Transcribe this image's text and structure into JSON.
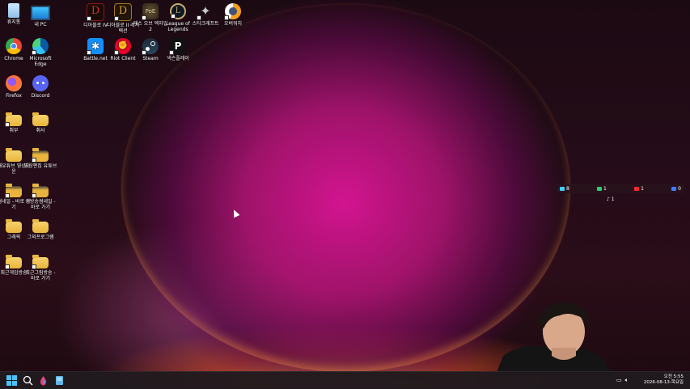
{
  "desktop_icons": [
    {
      "label": "휴지통",
      "icon": "recycle-bin-icon"
    },
    {
      "label": "내 PC",
      "icon": "pc-icon"
    },
    {
      "label": "Chrome",
      "icon": "chrome-icon"
    },
    {
      "label": "Microsoft Edge",
      "icon": "edge-icon"
    },
    {
      "label": "Firefox",
      "icon": "firefox-icon"
    },
    {
      "label": "Discord",
      "icon": "discord-icon"
    },
    {
      "label": "취부",
      "icon": "folder-icon"
    },
    {
      "label": "취사",
      "icon": "folder-icon"
    },
    {
      "label": "내유튜브 영상다운",
      "icon": "folder-icon"
    },
    {
      "label": "영상편집 유튜브",
      "icon": "folder-icon"
    },
    {
      "label": "썸네일 - 바로 가기",
      "icon": "folder-icon"
    },
    {
      "label": "생방송썸네일 - 바로 가기",
      "icon": "folder-icon"
    },
    {
      "label": "그래픽",
      "icon": "folder-icon"
    },
    {
      "label": "그외프로그램",
      "icon": "folder-icon"
    },
    {
      "label": "최근게임방송",
      "icon": "folder-icon"
    },
    {
      "label": "최근그림방송 - 바로 가기",
      "icon": "folder-icon"
    },
    {
      "label": "디아블로 IV",
      "icon": "diablo4-icon"
    },
    {
      "label": "디아블로 II 레저렉션",
      "icon": "diablo2-icon"
    },
    {
      "label": "패스 오브 엑자일2",
      "icon": "poe2-icon"
    },
    {
      "label": "League of Legends",
      "icon": "lol-icon"
    },
    {
      "label": "스타크래프트",
      "icon": "starcraft-icon"
    },
    {
      "label": "오버워치",
      "icon": "overwatch-icon"
    },
    {
      "label": "Battle.net",
      "icon": "battlenet-icon"
    },
    {
      "label": "Riot Client",
      "icon": "riot-icon"
    },
    {
      "label": "Steam",
      "icon": "steam-icon"
    },
    {
      "label": "넥슨플레이",
      "icon": "nexon-icon"
    }
  ],
  "stream_overlay": {
    "items": [
      {
        "platform": "chzzk",
        "count": "8",
        "color": "#3fd0ff"
      },
      {
        "platform": "afreeca",
        "count": "1",
        "color": "#2ecc71"
      },
      {
        "platform": "youtube",
        "count": "1",
        "color": "#ff2a2a"
      },
      {
        "platform": "kick",
        "count": "0",
        "color": "#3d7bff"
      }
    ],
    "tiktok_count": "1"
  },
  "taskbar": {
    "time": "오전 5:55",
    "date": "2026-08-13-목요일"
  },
  "colors": {
    "accent": "#d4148f",
    "taskbar": "#201a1e",
    "folder": "#e8b43d"
  }
}
